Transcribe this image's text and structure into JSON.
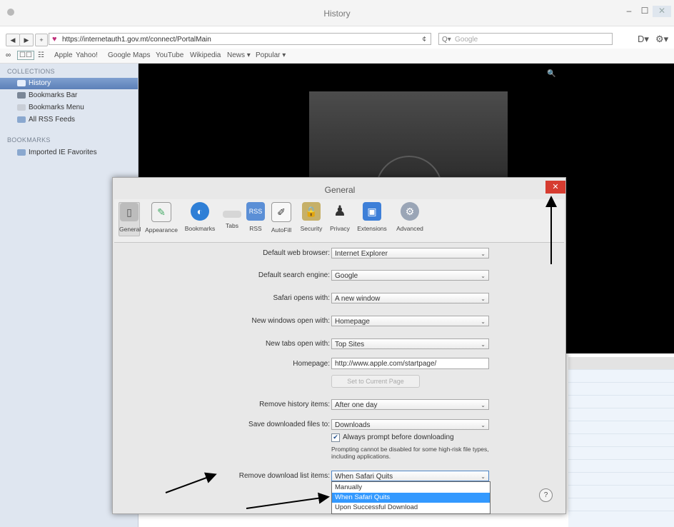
{
  "window": {
    "title": "History",
    "minimize_glyph": "–",
    "maximize_glyph": "☐",
    "close_glyph": "✕"
  },
  "toolbar": {
    "back_glyph": "◀",
    "forward_glyph": "▶",
    "add_glyph": "+",
    "url": "https://internetauth1.gov.mt/connect/PortalMain",
    "reload_glyph": "¢",
    "search_placeholder": "Google",
    "search_prefix": "Q▾",
    "page_menu_glyph": "D▾",
    "settings_menu_glyph": "⚙▾"
  },
  "bookmarks_bar": {
    "items": [
      "Apple",
      "Yahoo!",
      "Google Maps",
      "YouTube",
      "Wikipedia",
      "News ▾",
      "Popular ▾"
    ]
  },
  "sidebar": {
    "collections_heading": "COLLECTIONS",
    "collections": [
      "History",
      "Bookmarks Bar",
      "Bookmarks Menu",
      "All RSS Feeds"
    ],
    "bookmarks_heading": "BOOKMARKS",
    "bookmarks": [
      "Imported IE Favorites"
    ]
  },
  "dialog": {
    "title": "General",
    "close_glyph": "✕",
    "tabs": [
      {
        "label": "General",
        "icon": "switch-icon"
      },
      {
        "label": "Appearance",
        "icon": "appearance-icon"
      },
      {
        "label": "Bookmarks",
        "icon": "globe-icon"
      },
      {
        "label": "Tabs",
        "icon": "tabs-icon"
      },
      {
        "label": "RSS",
        "icon": "rss-icon"
      },
      {
        "label": "AutoFill",
        "icon": "pencil-icon"
      },
      {
        "label": "Security",
        "icon": "lock-icon"
      },
      {
        "label": "Privacy",
        "icon": "person-icon"
      },
      {
        "label": "Extensions",
        "icon": "puzzle-icon"
      },
      {
        "label": "Advanced",
        "icon": "gear-icon"
      }
    ],
    "rss_badge": "RSS",
    "fields": {
      "default_browser_label": "Default web browser:",
      "default_browser_value": "Internet Explorer",
      "search_engine_label": "Default search engine:",
      "search_engine_value": "Google",
      "safari_opens_label": "Safari opens with:",
      "safari_opens_value": "A new window",
      "new_windows_label": "New windows open with:",
      "new_windows_value": "Homepage",
      "new_tabs_label": "New tabs open with:",
      "new_tabs_value": "Top Sites",
      "homepage_label": "Homepage:",
      "homepage_value": "http://www.apple.com/startpage/",
      "set_current_label": "Set to Current Page",
      "remove_history_label": "Remove history items:",
      "remove_history_value": "After one day",
      "save_downloads_label": "Save downloaded files to:",
      "save_downloads_value": "Downloads",
      "always_prompt_label": "Always prompt before downloading",
      "always_prompt_check": "✔",
      "prompt_note": "Prompting cannot be disabled for some high-risk file types, including applications.",
      "remove_download_label": "Remove download list items:",
      "remove_download_value": "When Safari Quits",
      "remove_download_options": [
        "Manually",
        "When Safari Quits",
        "Upon Successful Download"
      ]
    },
    "help_glyph": "?"
  },
  "dropdown_arrow": "⌄"
}
